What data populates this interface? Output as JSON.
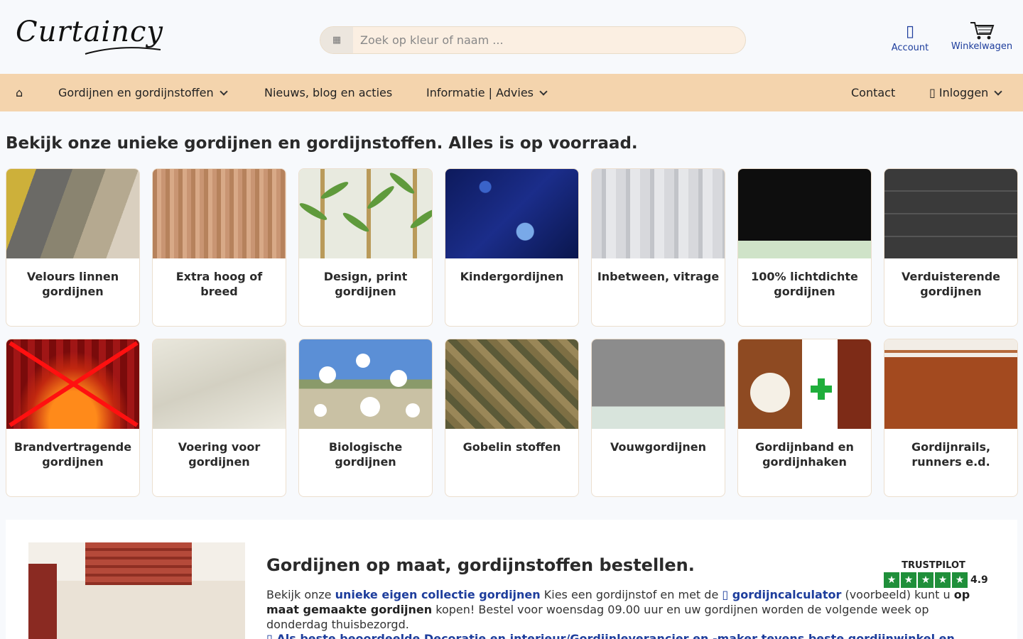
{
  "header": {
    "logo_text": "Curtaincy",
    "search_placeholder": "Zoek op kleur of naam ...",
    "search_icon": "grid-icon",
    "account_label": "Account",
    "cart_label": "Winkelwagen"
  },
  "nav": {
    "home_icon": "⌂",
    "items": [
      {
        "label": "Gordijnen en gordijnstoffen",
        "dropdown": true
      },
      {
        "label": "Nieuws, blog en acties",
        "dropdown": false
      },
      {
        "label": "Informatie | Advies",
        "dropdown": true
      }
    ],
    "contact_label": "Contact",
    "login_label": "Inloggen"
  },
  "section_title": "Bekijk onze unieke gordijnen en gordijnstoffen. Alles is op voorraad.",
  "categories": [
    {
      "label": "Velours linnen gordijnen"
    },
    {
      "label": "Extra hoog of breed"
    },
    {
      "label": "Design, print gordijnen"
    },
    {
      "label": "Kindergordijnen"
    },
    {
      "label": "Inbetween, vitrage"
    },
    {
      "label": "100% lichtdichte gordijnen"
    },
    {
      "label": "Verduisterende gordijnen"
    },
    {
      "label": "Brandvertragende gordijnen"
    },
    {
      "label": "Voering voor gordijnen"
    },
    {
      "label": "Biologische gordijnen"
    },
    {
      "label": "Gobelin stoffen"
    },
    {
      "label": "Vouwgordijnen"
    },
    {
      "label": "Gordijnband en gordijnhaken"
    },
    {
      "label": "Gordijnrails, runners e.d."
    }
  ],
  "promo": {
    "title": "Gordijnen op maat, gordijnstoffen bestellen.",
    "text_1": "Bekijk onze ",
    "link_1": "unieke eigen collectie gordijnen",
    "text_2": " Kies een gordijnstof en met de ",
    "link_2": "gordijncalculator",
    "text_3": " (voorbeeld) kunt u ",
    "bold_1": "op maat gemaakte gordijnen",
    "text_4": " kopen! Bestel voor woensdag 09.00 uur en uw gordijnen worden de volgende week op donderdag thuisbezorgd.",
    "more_link": "Als beste beoordeelde Decoratie en interieur/Gordijnleverancier en -maker tevens beste gordijnwinkel en"
  },
  "trustpilot": {
    "title": "TRUSTPILOT",
    "score": "4.9",
    "color": "#1f8f3a"
  }
}
